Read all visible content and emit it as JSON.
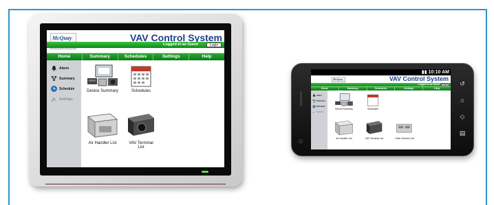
{
  "app": {
    "logo_text": "McQuay",
    "logo_subtext": "INTERNATIONAL",
    "title": "VAV Control System",
    "status": "Logged in as Guest",
    "login_label": "Login",
    "nav": [
      "Home",
      "Summary",
      "Schedules",
      "Settings",
      "Help"
    ],
    "sidebar": [
      {
        "label": "Alarm",
        "icon": "alarm-bell-icon"
      },
      {
        "label": "Summary",
        "icon": "summary-network-icon"
      },
      {
        "label": "Schedule",
        "icon": "schedule-clock-icon"
      },
      {
        "label": "Settings",
        "icon": "settings-tools-icon",
        "disabled": true
      }
    ],
    "tiles": {
      "device_summary": "Device Summary",
      "schedules": "Schedules",
      "air_handler": "Air Handler List",
      "vav_terminal_line1": "VAV Terminal",
      "vav_terminal_line2": "List",
      "vav_terminal_full": "VAV Terminal List",
      "other_devices": "Other Devices List"
    }
  },
  "phone": {
    "clock": "10:10 AM"
  },
  "colors": {
    "frame_border": "#2a96c8",
    "nav_green": "#1a8f22",
    "title_blue": "#1f3e87",
    "sidebar_grey": "#cfd1d4"
  }
}
